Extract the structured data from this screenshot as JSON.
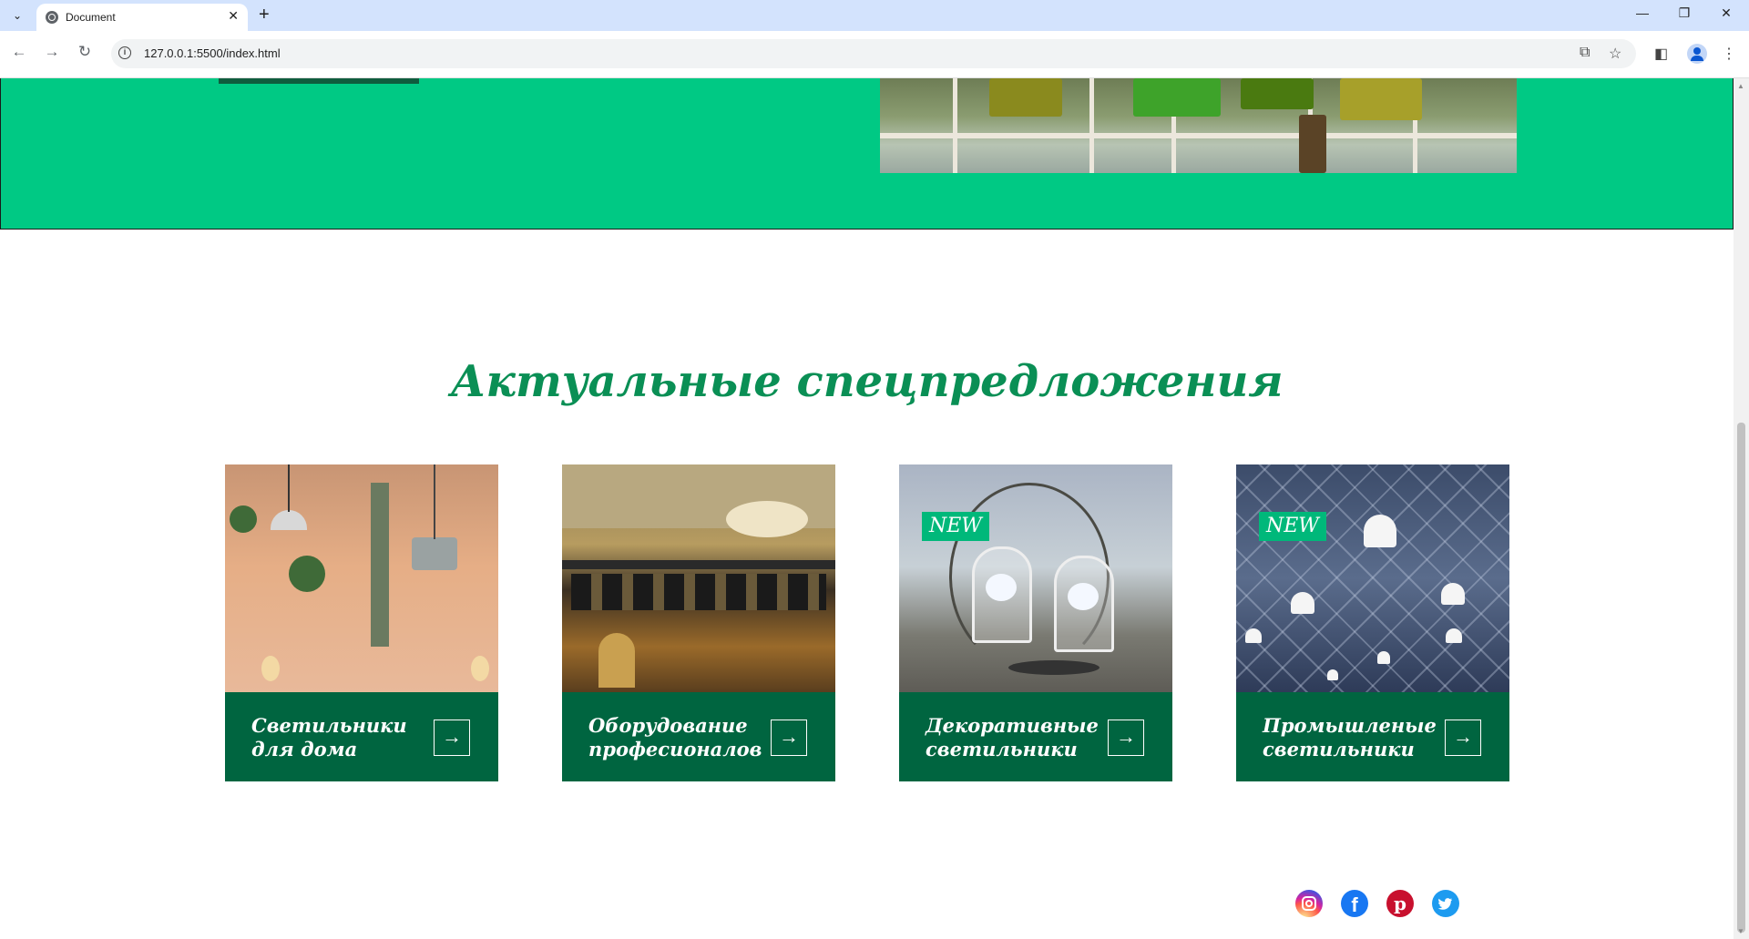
{
  "browser": {
    "tab_title": "Document",
    "url": "127.0.0.1:5500/index.html",
    "new_tab": "+",
    "close_tab": "✕"
  },
  "section": {
    "title": "Актуальные спецпредложения"
  },
  "cards": [
    {
      "label": "Светильники для дома",
      "arrow": "→",
      "badge": ""
    },
    {
      "label": "Оборудование професионалов",
      "arrow": "→",
      "badge": ""
    },
    {
      "label": "Декоративные светильники",
      "arrow": "→",
      "badge": "NEW"
    },
    {
      "label": "Промышленые светильники",
      "arrow": "→",
      "badge": "NEW"
    }
  ],
  "social": [
    "instagram-icon",
    "facebook-icon",
    "pinterest-icon",
    "twitter-icon"
  ],
  "colors": {
    "hero_bg": "#00c984",
    "card_footer": "#006540",
    "title": "#0a8f55",
    "badge": "#00b87a"
  }
}
